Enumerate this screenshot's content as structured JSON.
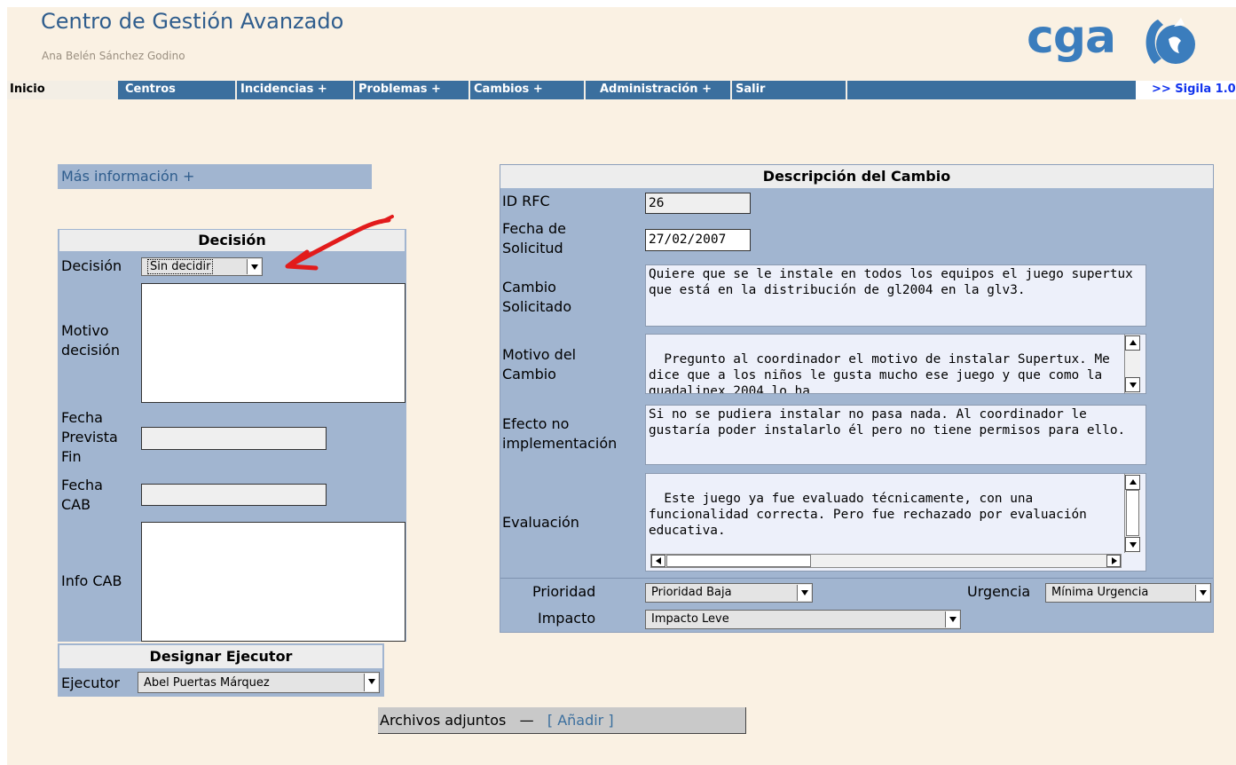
{
  "header": {
    "title": "Centro de Gestión Avanzado",
    "user": "Ana Belén Sánchez Godino",
    "logo_text": "cga"
  },
  "nav": {
    "items": [
      "Inicio",
      "Centros",
      "Incidencias +",
      "Problemas +",
      "Cambios +",
      "Administración +",
      "Salir"
    ],
    "sigila": ">> Sigila 1.0"
  },
  "more_info": "Más información   +",
  "decision": {
    "header": "Decisión",
    "decision_label": "Decisión",
    "decision_value": "Sin decidir",
    "motivo_label": "Motivo decisión",
    "fecha_fin_label": "Fecha Prevista Fin",
    "fecha_cab_label": "Fecha CAB",
    "info_cab_label": "Info CAB"
  },
  "executor": {
    "header": "Designar Ejecutor",
    "label": "Ejecutor",
    "value": "Abel Puertas Márquez"
  },
  "change": {
    "header": "Descripción del Cambio",
    "id_label": "ID RFC",
    "id_value": "26",
    "fecha_label": "Fecha de Solicitud",
    "fecha_value": "27/02/2007",
    "cambio_label": "Cambio Solicitado",
    "cambio_text": "Quiere que se le instale en todos los equipos el juego supertux que está en la distribución de gl2004 en la glv3.",
    "motivo_label": "Motivo del Cambio",
    "motivo_text": "Pregunto al coordinador el motivo de instalar Supertux. Me dice que a los niños le gusta mucho ese juego y que como la guadalinex 2004 lo ha",
    "efecto_label": "Efecto no implementación",
    "efecto_text": "Si no se pudiera instalar no pasa nada. Al coordinador le gustaría poder instalarlo él pero no tiene permisos para ello.",
    "evaluacion_label": "Evaluación",
    "evaluacion_text": "Este juego ya fue evaluado técnicamente, con una funcionalidad correcta. Pero fue rechazado por evaluación educativa.",
    "prioridad_label": "Prioridad",
    "prioridad_value": "Prioridad Baja",
    "urgencia_label": "Urgencia",
    "urgencia_value": "Mínima Urgencia",
    "impacto_label": "Impacto",
    "impacto_value": "Impacto Leve"
  },
  "attachments": {
    "label": "Archivos adjuntos",
    "dash": "—",
    "add_link": "[ Añadir ]"
  },
  "colors": {
    "page_bg": "#faf1e3",
    "nav_bg": "#3b6f9e",
    "panel_bg": "#a1b5d0",
    "title": "#2f5d8d",
    "annotation_arrow": "#e21b1b"
  }
}
